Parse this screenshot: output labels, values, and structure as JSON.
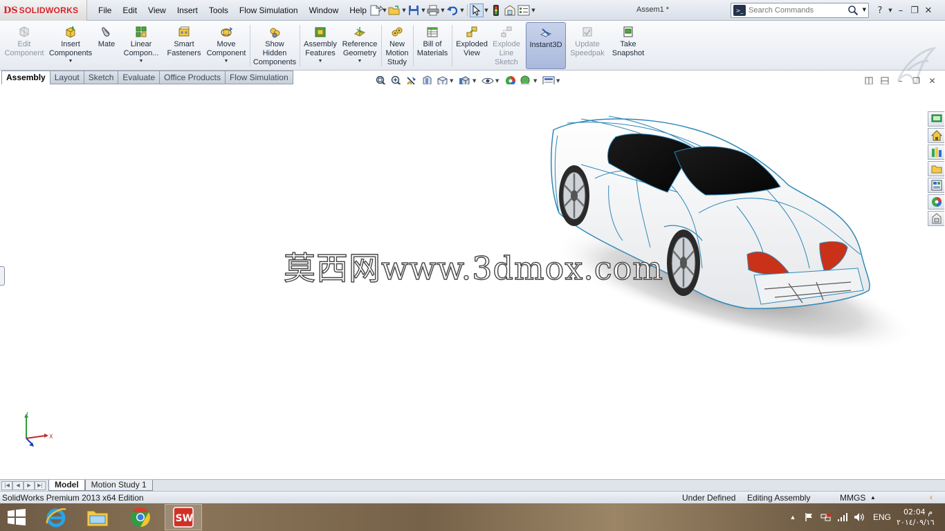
{
  "app": {
    "logo_mark": "DS",
    "logo_name": "SOLIDWORKS",
    "document_title": "Assem1 *"
  },
  "menu": [
    "File",
    "Edit",
    "View",
    "Insert",
    "Tools",
    "Flow Simulation",
    "Window",
    "Help"
  ],
  "search": {
    "placeholder": "Search Commands"
  },
  "commands": [
    {
      "label": "Edit\nComponent",
      "icon": "edit-component-icon",
      "disabled": true
    },
    {
      "label": "Insert\nComponents",
      "icon": "insert-components-icon",
      "dropdown": true
    },
    {
      "label": "Mate",
      "icon": "mate-icon"
    },
    {
      "label": "Linear\nCompon...",
      "icon": "linear-pattern-icon",
      "dropdown": true
    },
    {
      "label": "Smart\nFasteners",
      "icon": "smart-fasteners-icon"
    },
    {
      "label": "Move\nComponent",
      "icon": "move-component-icon",
      "dropdown": true
    },
    {
      "label": "Show\nHidden\nComponents",
      "icon": "show-hidden-icon"
    },
    {
      "label": "Assembly\nFeatures",
      "icon": "assembly-features-icon",
      "dropdown": true
    },
    {
      "label": "Reference\nGeometry",
      "icon": "reference-geometry-icon",
      "dropdown": true
    },
    {
      "label": "New\nMotion\nStudy",
      "icon": "motion-study-icon"
    },
    {
      "label": "Bill of\nMaterials",
      "icon": "bill-of-materials-icon"
    },
    {
      "label": "Exploded\nView",
      "icon": "exploded-view-icon"
    },
    {
      "label": "Explode\nLine\nSketch",
      "icon": "explode-line-icon",
      "disabled": true
    },
    {
      "label": "Instant3D",
      "icon": "instant3d-icon",
      "active": true
    },
    {
      "label": "Update\nSpeedpak",
      "icon": "speedpak-icon",
      "disabled": true
    },
    {
      "label": "Take\nSnapshot",
      "icon": "snapshot-icon"
    }
  ],
  "tabs": [
    {
      "label": "Assembly",
      "active": true
    },
    {
      "label": "Layout"
    },
    {
      "label": "Sketch"
    },
    {
      "label": "Evaluate"
    },
    {
      "label": "Office Products"
    },
    {
      "label": "Flow Simulation"
    }
  ],
  "viewport": {
    "watermark": "莫西网www.3dmox.com",
    "triad": {
      "x_label": "X",
      "y_label": "Y"
    }
  },
  "bottom_tabs": [
    {
      "label": "Model",
      "active": true
    },
    {
      "label": "Motion Study 1"
    }
  ],
  "status": {
    "edition": "SolidWorks Premium 2013 x64 Edition",
    "definition": "Under Defined",
    "mode": "Editing Assembly",
    "units": "MMGS",
    "units_arrow": "▲"
  },
  "taskbar": {
    "language": "ENG",
    "time": "02:04 م",
    "date": "٢٠١٤/٠٩/١٦"
  }
}
